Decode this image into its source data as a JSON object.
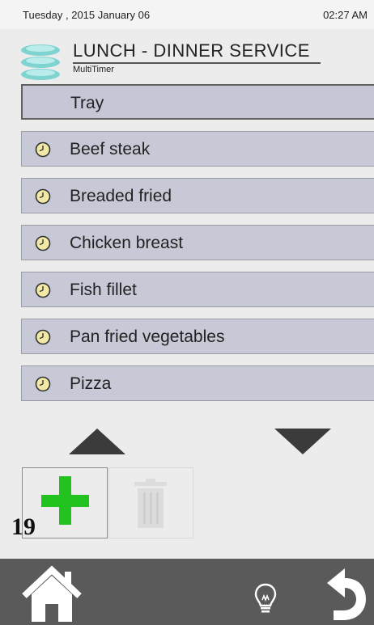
{
  "status": {
    "date": "Tuesday , 2015 January 06",
    "time": "02:27 AM"
  },
  "header": {
    "title": "LUNCH - DINNER SERVICE",
    "subtitle": "MultiTimer"
  },
  "list": {
    "selected": "Tray",
    "items": [
      "Beef steak",
      "Breaded fried",
      "Chicken breast",
      "Fish fillet",
      "Pan fried vegetables",
      "Pizza"
    ]
  },
  "actions": {
    "count": "19"
  },
  "icons": {
    "logo": "stacked-plates-icon",
    "timer": "clock-icon",
    "add": "plus-icon",
    "delete": "trash-icon",
    "home": "home-icon",
    "tip": "lightbulb-icon",
    "back": "undo-arrow-icon"
  },
  "colors": {
    "row_bg": "#c7c9d7",
    "add_green": "#22c21f",
    "clock_yellow": "#f2e9a6",
    "bottombar": "#5a5a5a"
  }
}
